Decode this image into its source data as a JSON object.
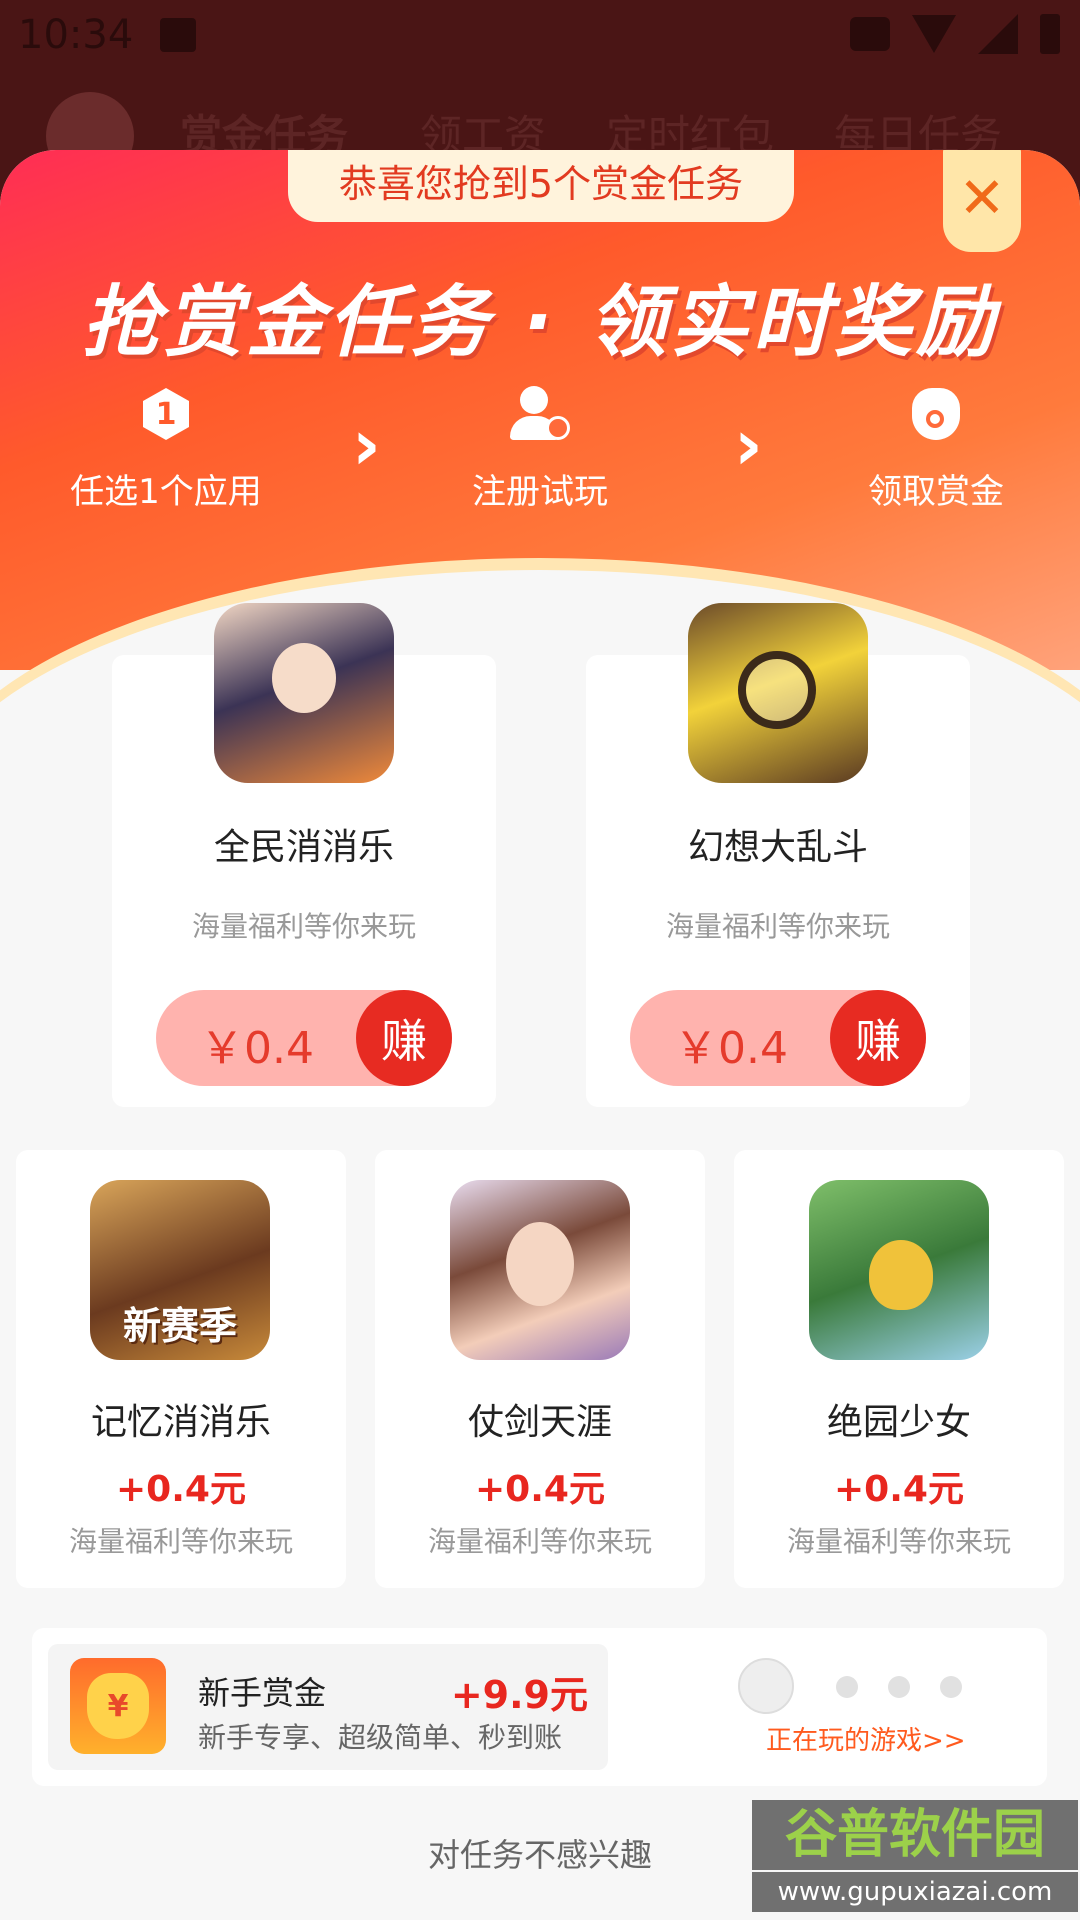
{
  "statusbar": {
    "time": "10:34"
  },
  "background_tabs": [
    "赏金任务",
    "领工资",
    "定时红包",
    "每日任务"
  ],
  "dialog": {
    "congrats": "恭喜您抢到5个赏金任务",
    "close_glyph": "✕",
    "headline": "抢赏金任务 · 领实时奖励",
    "steps": [
      {
        "icon": "hexagon-number-icon",
        "icon_text": "1",
        "label": "任选1个应用"
      },
      {
        "icon": "user-add-icon",
        "label": "注册试玩"
      },
      {
        "icon": "money-bag-icon",
        "label": "领取赏金"
      }
    ],
    "arrow_glyph": "›",
    "featured": [
      {
        "name": "全民消消乐",
        "desc": "海量福利等你来玩",
        "price": "￥0.4",
        "earn_label": "赚",
        "icon": "game-icon-girl"
      },
      {
        "name": "幻想大乱斗",
        "desc": "海量福利等你来玩",
        "price": "￥0.4",
        "earn_label": "赚",
        "icon": "game-icon-pikachu"
      }
    ],
    "apps": [
      {
        "name": "记忆消消乐",
        "reward": "+0.4元",
        "desc": "海量福利等你来玩",
        "icon": "game-icon-warrior",
        "icon_text": "新赛季"
      },
      {
        "name": "仗剑天涯",
        "reward": "+0.4元",
        "desc": "海量福利等你来玩",
        "icon": "game-icon-lady"
      },
      {
        "name": "绝园少女",
        "reward": "+0.4元",
        "desc": "海量福利等你来玩",
        "icon": "game-icon-plant"
      }
    ],
    "newbie": {
      "title": "新手赏金",
      "subtitle": "新手专享、超级简单、秒到账",
      "reward": "+9.9元",
      "bag_text": "¥"
    },
    "playing_link": "正在玩的游戏>>",
    "not_interested": "对任务不感兴趣"
  },
  "watermark": {
    "title": "谷普软件园",
    "url": "www.gupuxiazai.com"
  },
  "colors": {
    "accent": "#e8271f",
    "header_start": "#ff2d55",
    "header_end": "#ff7a3c"
  }
}
